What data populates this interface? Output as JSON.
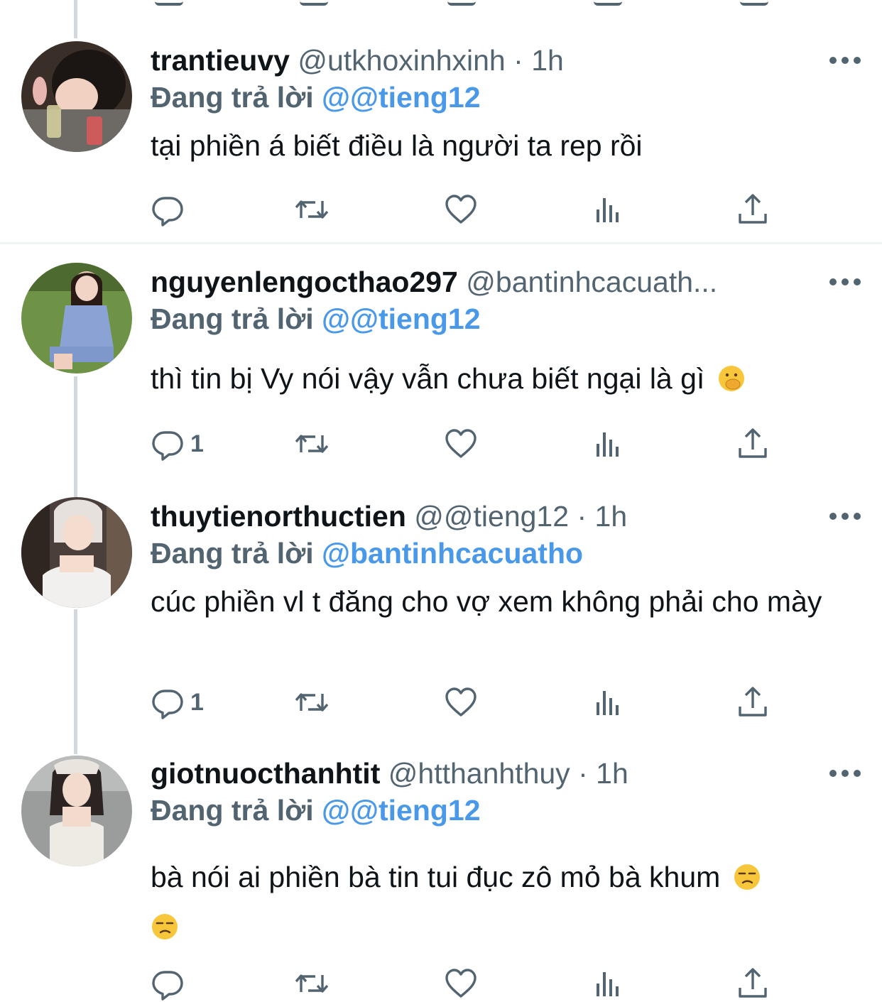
{
  "colors": {
    "text": "#0f1419",
    "muted": "#536471",
    "link": "#4a99e9",
    "line": "#cfd9de"
  },
  "tweets": [
    {
      "name": "trantieuvy",
      "handle": "@utkhoxinhxinh",
      "dot": "·",
      "time": "1h",
      "reply_prefix": "Đang trả lời",
      "reply_to": "@@tieng12",
      "body": "tại phiền á biết điều là người ta rep rồi",
      "emoji": "",
      "reply_count": ""
    },
    {
      "name": "nguyenlengocthao297",
      "handle": "@bantinhcacuath...",
      "dot": "",
      "time": "",
      "reply_prefix": "Đang trả lời",
      "reply_to": "@@tieng12",
      "body": "thì tin bị Vy nói vậy vẫn chưa biết ngại là gì",
      "emoji": "face-with-hand-over-mouth",
      "reply_count": "1"
    },
    {
      "name": "thuytienorthuctien",
      "handle": "@@tieng12",
      "dot": "·",
      "time": "1h",
      "reply_prefix": "Đang trả lời",
      "reply_to": "@bantinhcacuatho",
      "body": "cúc phiền vl t đăng cho vợ xem không phải cho mày",
      "emoji": "",
      "reply_count": "1"
    },
    {
      "name": "giotnuocthanhtit",
      "handle": "@htthanhthuy",
      "dot": "·",
      "time": "1h",
      "reply_prefix": "Đang trả lời",
      "reply_to": "@@tieng12",
      "body": "bà nói ai phiền bà tin tui đục zô mỏ bà khum",
      "emoji": "unamused-face",
      "reply_count": ""
    }
  ],
  "icons": [
    "reply-icon",
    "retweet-icon",
    "like-icon",
    "views-icon",
    "share-icon",
    "more-icon"
  ]
}
